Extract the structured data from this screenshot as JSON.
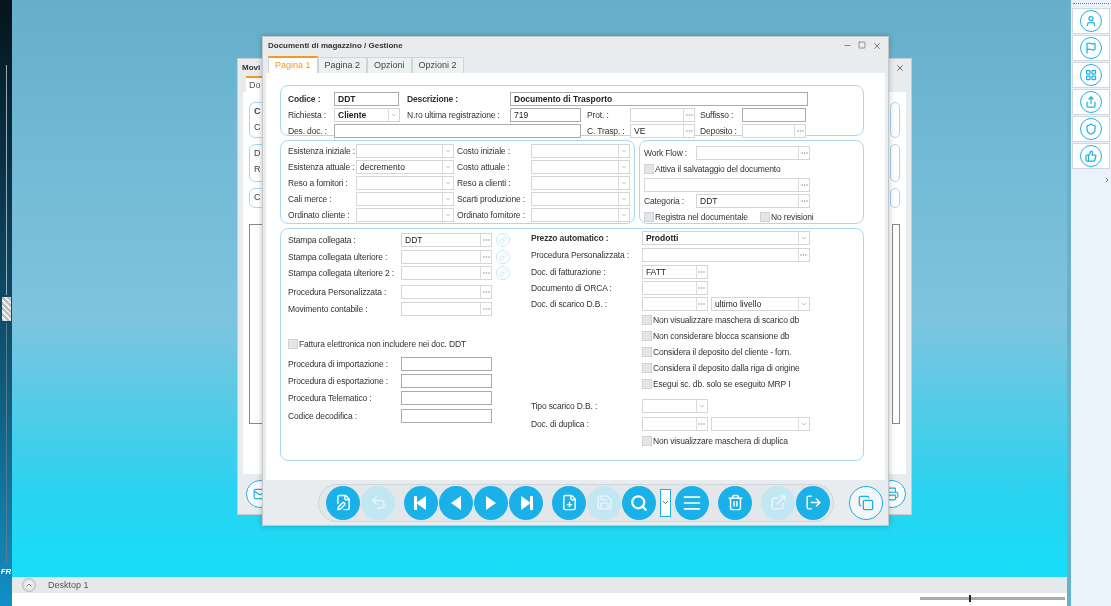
{
  "left_bar": {
    "label": "FR"
  },
  "background_window": {
    "title": "Movi",
    "tab": "Do",
    "fragments": [
      "C",
      "C",
      "D",
      "R",
      "C"
    ]
  },
  "window": {
    "title": "Documenti di magazzino / Gestione"
  },
  "tabs": [
    {
      "label": "Pagina 1",
      "selected": true
    },
    {
      "label": "Pagina 2",
      "selected": false
    },
    {
      "label": "Opzioni",
      "selected": false
    },
    {
      "label": "Opzioni 2",
      "selected": false
    }
  ],
  "header": {
    "lines": [
      {
        "items": [
          {
            "kind": "field",
            "label": "Codice :",
            "bold": true,
            "controls": [
              {
                "kind": "text",
                "value": "DDT",
                "bold": true
              }
            ]
          },
          {
            "kind": "field",
            "label": "Descrizione :",
            "bold": true,
            "controls": [
              {
                "kind": "text",
                "value": "Documento di Trasporto",
                "bold": true
              }
            ]
          }
        ]
      },
      {
        "items": [
          {
            "kind": "field",
            "label": "Richiesta :",
            "controls": [
              {
                "kind": "combo",
                "value": "Cliente",
                "bold": true
              }
            ]
          },
          {
            "kind": "field",
            "label": "N.ro ultima registrazione :",
            "controls": [
              {
                "kind": "text",
                "value": "719"
              }
            ]
          },
          {
            "kind": "field",
            "label": "Prot. :",
            "controls": [
              {
                "kind": "lookup"
              }
            ]
          },
          {
            "kind": "field",
            "label": "Suffisso :",
            "controls": [
              {
                "kind": "text"
              }
            ]
          }
        ]
      },
      {
        "items": [
          {
            "kind": "field",
            "label": "Des. doc. :",
            "controls": [
              {
                "kind": "text"
              }
            ]
          },
          {
            "kind": "field",
            "label": "C. Trasp. :",
            "controls": [
              {
                "kind": "lookup",
                "value": "VE"
              }
            ]
          },
          {
            "kind": "field",
            "label": "Deposito :",
            "controls": [
              {
                "kind": "lookup"
              }
            ]
          }
        ]
      }
    ]
  },
  "stock": {
    "rows": [
      [
        {
          "kind": "field",
          "label": "Esistenza iniziale :",
          "controls": [
            {
              "kind": "combo"
            }
          ]
        },
        {
          "kind": "field",
          "label": "Costo iniziale :",
          "controls": [
            {
              "kind": "combo"
            }
          ]
        }
      ],
      [
        {
          "kind": "field",
          "label": "Esistenza attuale :",
          "controls": [
            {
              "kind": "combo",
              "value": "decremento"
            }
          ]
        },
        {
          "kind": "field",
          "label": "Costo attuale :",
          "controls": [
            {
              "kind": "combo"
            }
          ]
        }
      ],
      [
        {
          "kind": "field",
          "label": "Reso a fornitori :",
          "controls": [
            {
              "kind": "combo"
            }
          ]
        },
        {
          "kind": "field",
          "label": "Reso a clienti :",
          "controls": [
            {
              "kind": "combo"
            }
          ]
        }
      ],
      [
        {
          "kind": "field",
          "label": "Cali merce :",
          "controls": [
            {
              "kind": "combo"
            }
          ]
        },
        {
          "kind": "field",
          "label": "Scarti produzione :",
          "controls": [
            {
              "kind": "combo"
            }
          ]
        }
      ],
      [
        {
          "kind": "field",
          "label": "Ordinato cliente :",
          "controls": [
            {
              "kind": "combo"
            }
          ]
        },
        {
          "kind": "field",
          "label": "Ordinato fornitore :",
          "controls": [
            {
              "kind": "combo"
            }
          ]
        }
      ]
    ]
  },
  "workflow": {
    "rows": [
      [
        {
          "kind": "field",
          "label": "Work Flow :",
          "controls": [
            {
              "kind": "lookup"
            }
          ]
        }
      ],
      [
        {
          "kind": "check",
          "label": "Attiva il salvataggio del documento",
          "checked": false
        }
      ],
      [
        {
          "kind": "field",
          "controls": [
            {
              "kind": "lookup"
            }
          ]
        }
      ],
      [
        {
          "kind": "field",
          "label": "Categoria :",
          "controls": [
            {
              "kind": "lookup",
              "value": "DDT"
            }
          ]
        }
      ],
      [
        {
          "kind": "check",
          "label": "Registra nel documentale",
          "checked": false
        },
        {
          "kind": "check",
          "label": "No revisioni",
          "checked": false
        }
      ]
    ]
  },
  "print": {
    "left": [
      [
        {
          "kind": "field",
          "label": "Stampa collegata :",
          "controls": [
            {
              "kind": "lookup",
              "value": "DDT"
            }
          ],
          "link_button": true
        }
      ],
      [
        {
          "kind": "field",
          "label": "Stampa collegata ulteriore :",
          "controls": [
            {
              "kind": "lookup"
            }
          ],
          "link_button": true
        }
      ],
      [
        {
          "kind": "field",
          "label": "Stampa collegata ulteriore 2 :",
          "controls": [
            {
              "kind": "lookup"
            }
          ],
          "link_button": true
        }
      ],
      [
        {
          "kind": "field",
          "label": "Procedura Personalizzata :",
          "controls": [
            {
              "kind": "lookup"
            }
          ]
        }
      ],
      [
        {
          "kind": "field",
          "label": "Movimento contabile :",
          "controls": [
            {
              "kind": "lookup"
            }
          ]
        }
      ],
      [
        {
          "kind": "check",
          "label": "Fattura elettronica non includere nei doc. DDT",
          "checked": false
        }
      ],
      [
        {
          "kind": "field",
          "label": "Procedura di importazione :",
          "controls": [
            {
              "kind": "text"
            }
          ]
        }
      ],
      [
        {
          "kind": "field",
          "label": "Procedura di esportazione :",
          "controls": [
            {
              "kind": "text"
            }
          ]
        }
      ],
      [
        {
          "kind": "field",
          "label": "Procedura Telematico :",
          "controls": [
            {
              "kind": "text"
            }
          ]
        }
      ],
      [
        {
          "kind": "field",
          "label": "Codice decodifica :",
          "controls": [
            {
              "kind": "text"
            }
          ]
        }
      ]
    ],
    "right": [
      [
        {
          "kind": "field",
          "label": "Prezzo automatico :",
          "bold": true,
          "controls": [
            {
              "kind": "combo",
              "value": "Prodotti",
              "bold": true
            }
          ]
        }
      ],
      [
        {
          "kind": "field",
          "label": "Procedura Personalizzata :",
          "controls": [
            {
              "kind": "lookup"
            }
          ]
        }
      ],
      [
        {
          "kind": "field",
          "label": "Doc. di fatturazione :",
          "controls": [
            {
              "kind": "lookup",
              "value": "FATT"
            }
          ]
        }
      ],
      [
        {
          "kind": "field",
          "label": "Documento di ORCA :",
          "controls": [
            {
              "kind": "lookup"
            }
          ]
        }
      ],
      [
        {
          "kind": "field",
          "label": "Doc. di scarico D.B. :",
          "controls": [
            {
              "kind": "lookup"
            },
            {
              "kind": "combo",
              "value": "ultimo livello"
            }
          ]
        }
      ],
      [
        {
          "kind": "check",
          "label": "Non visualizzare maschera di scarico db",
          "checked": false
        }
      ],
      [
        {
          "kind": "check",
          "label": "Non considerare blocca scansione db",
          "checked": false
        }
      ],
      [
        {
          "kind": "check",
          "label": "Considera il deposito del cliente - forn.",
          "checked": false
        }
      ],
      [
        {
          "kind": "check",
          "label": "Considera il deposito dalla riga di origine",
          "checked": false
        }
      ],
      [
        {
          "kind": "check",
          "label": "Esegui sc. db. solo se eseguito MRP I",
          "checked": false
        }
      ],
      [
        {
          "kind": "field",
          "label": "Tipo scarico D.B. :",
          "controls": [
            {
              "kind": "combo"
            }
          ]
        }
      ],
      [
        {
          "kind": "field",
          "label": "Doc. di duplica :",
          "controls": [
            {
              "kind": "lookup"
            },
            {
              "kind": "combo"
            }
          ]
        }
      ],
      [
        {
          "kind": "check",
          "label": "Non visualizzare maschera di duplica",
          "checked": false
        }
      ]
    ]
  },
  "toolbar": {
    "groups": [
      [
        {
          "kind": "button",
          "disabled": false
        },
        {
          "kind": "button",
          "disabled": true
        }
      ],
      [
        {
          "kind": "button",
          "disabled": false
        },
        {
          "kind": "button",
          "disabled": false
        },
        {
          "kind": "button",
          "disabled": false
        },
        {
          "kind": "button",
          "disabled": false
        }
      ],
      [
        {
          "kind": "button",
          "disabled": false
        },
        {
          "kind": "button",
          "disabled": true
        },
        {
          "kind": "button",
          "disabled": false
        },
        {
          "kind": "dropdown",
          "disabled": false
        },
        {
          "kind": "button",
          "disabled": false
        }
      ],
      [
        {
          "kind": "button",
          "disabled": false
        }
      ],
      [
        {
          "kind": "button",
          "disabled": true
        },
        {
          "kind": "button",
          "disabled": false
        }
      ]
    ]
  },
  "taskbar": {
    "label": "Desktop 1"
  },
  "zoom_slider": {
    "level": 0.34
  }
}
